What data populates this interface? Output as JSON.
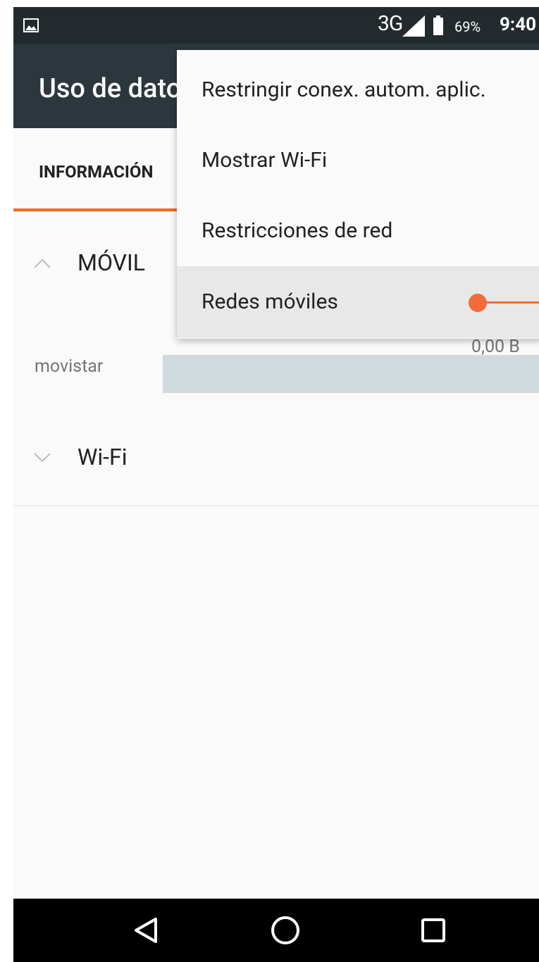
{
  "status_bar": {
    "network": "3G",
    "battery_percent": "69%",
    "time": "9:40",
    "icons": [
      "gallery-icon",
      "signal-icon",
      "battery-icon"
    ]
  },
  "app_bar": {
    "title": "Uso de datos"
  },
  "tabs": [
    {
      "label": "INFORMACIÓN"
    }
  ],
  "sections": {
    "mobile": {
      "title": "MÓVIL",
      "expanded": true,
      "operator": "movistar",
      "usage": "0,00 B"
    },
    "wifi": {
      "title": "Wi-Fi",
      "expanded": false
    }
  },
  "overflow_menu": {
    "items": [
      {
        "label": "Restringir conex. autom. aplic."
      },
      {
        "label": "Mostrar Wi-Fi"
      },
      {
        "label": "Restricciones de red"
      },
      {
        "label": "Redes móviles"
      }
    ],
    "highlighted_index": 3
  },
  "nav_bar": {
    "icons": [
      "back-icon",
      "home-icon",
      "recents-icon"
    ]
  },
  "colors": {
    "status_bar": "#222a2e",
    "app_bar": "#2c373d",
    "accent": "#f26b21",
    "usage_bar": "#cfdadf"
  }
}
